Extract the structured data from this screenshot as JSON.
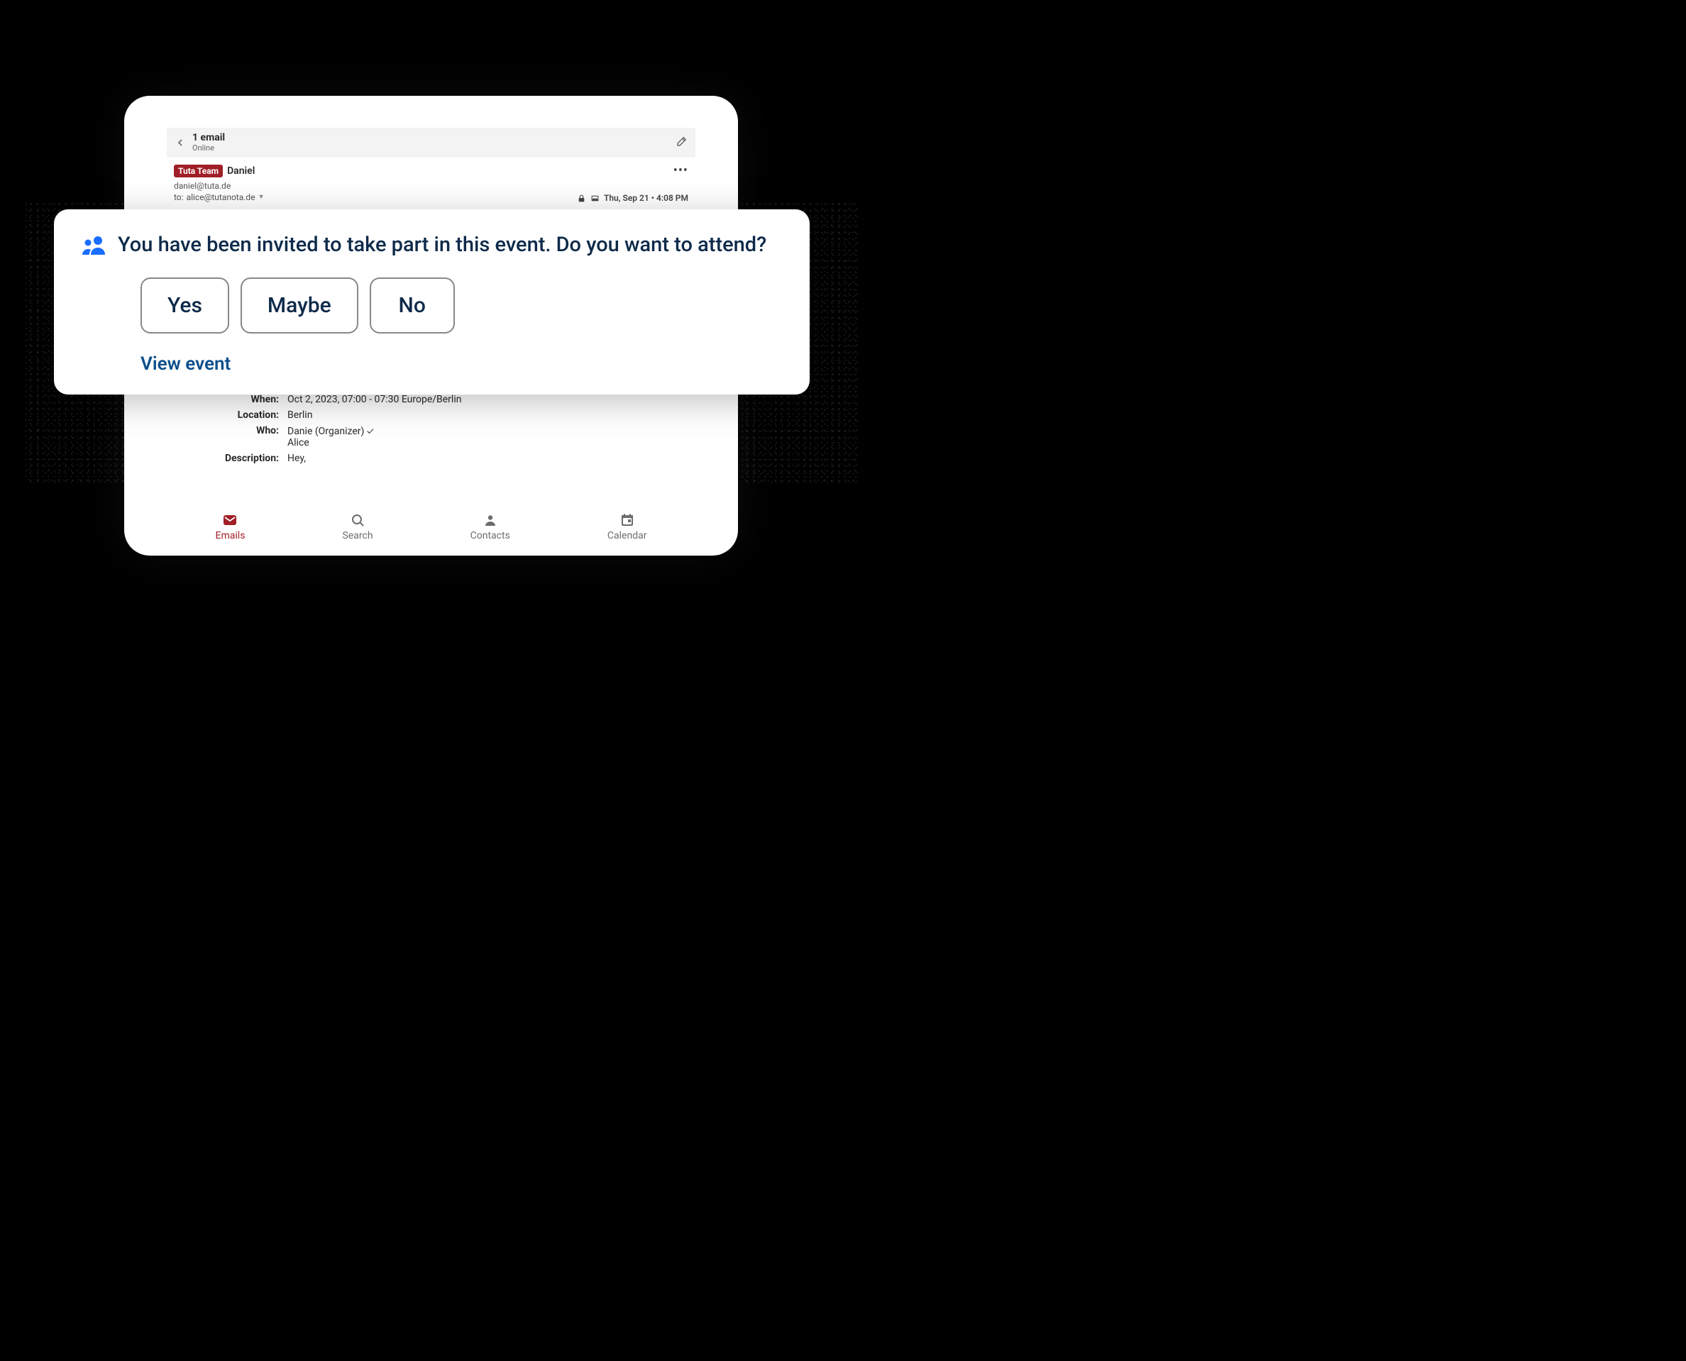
{
  "header": {
    "title": "1 email",
    "subtitle": "Online"
  },
  "email": {
    "team_badge": "Tuta Team",
    "sender_name": "Daniel",
    "sender_email": "daniel@tuta.de",
    "to_prefix": "to:",
    "to_email": "alice@tutanota.de",
    "timestamp": "Thu, Sep 21 • 4:08 PM"
  },
  "invite": {
    "prompt": "You have been invited to take part in this event. Do you want to attend?",
    "buttons": {
      "yes": "Yes",
      "maybe": "Maybe",
      "no": "No"
    },
    "view_event": "View event"
  },
  "event": {
    "when_label": "When:",
    "when": "Oct 2, 2023, 07:00 - 07:30 Europe/Berlin",
    "location_label": "Location:",
    "location": "Berlin",
    "who_label": "Who:",
    "who": "Danie (Organizer) ✓\nAlice",
    "description_label": "Description:",
    "description": "Hey,"
  },
  "nav": {
    "emails": "Emails",
    "search": "Search",
    "contacts": "Contacts",
    "calendar": "Calendar"
  }
}
